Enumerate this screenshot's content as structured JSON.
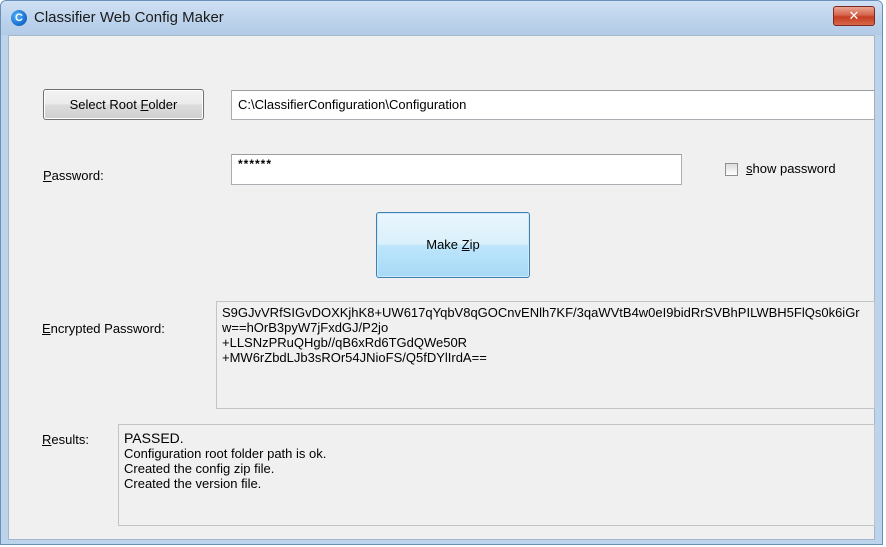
{
  "window": {
    "title": "Classifier Web Config Maker",
    "close_glyph": "✕",
    "app_icon_letter": "C"
  },
  "form": {
    "select_root_prefix": "Select Root ",
    "select_root_mnemonic": "F",
    "select_root_suffix": "older",
    "root_path": "C:\\ClassifierConfiguration\\Configuration",
    "password_mnemonic": "P",
    "password_suffix": "assword:",
    "password_mask": "******",
    "show_password_mnemonic": "s",
    "show_password_suffix": "how password",
    "show_password_checked": false,
    "make_zip_prefix": "Make ",
    "make_zip_mnemonic": "Z",
    "make_zip_suffix": "ip",
    "encrypted_mnemonic": "E",
    "encrypted_suffix": "ncrypted Password:",
    "encrypted_value": "S9GJvVRfSIGvDOXKjhK8+UW617qYqbV8qGOCnvENlh7KF/3qaWVtB4w0eI9bidRrSVBhPILWBH5FlQs0k6iGrw==hOrB3pyW7jFxdGJ/P2jo\n+LLSNzPRuQHgb//qB6xRd6TGdQWe50R\n+MW6rZbdLJb3sROr54JNioFS/Q5fDYlIrdA==",
    "results_mnemonic": "R",
    "results_suffix": "esults:",
    "results_lines": [
      "PASSED.",
      "Configuration root folder path is ok.",
      "Created the config zip file.",
      "Created the version file."
    ]
  },
  "colors": {
    "title_bar": "#bcd3ec",
    "client_bg": "#f0f0f0",
    "close_red": "#c63d22",
    "zip_button_blue": "#bee6fd"
  },
  "icons": {
    "app": "app-logo-icon",
    "close": "close-icon",
    "checkbox": "checkbox-icon"
  }
}
